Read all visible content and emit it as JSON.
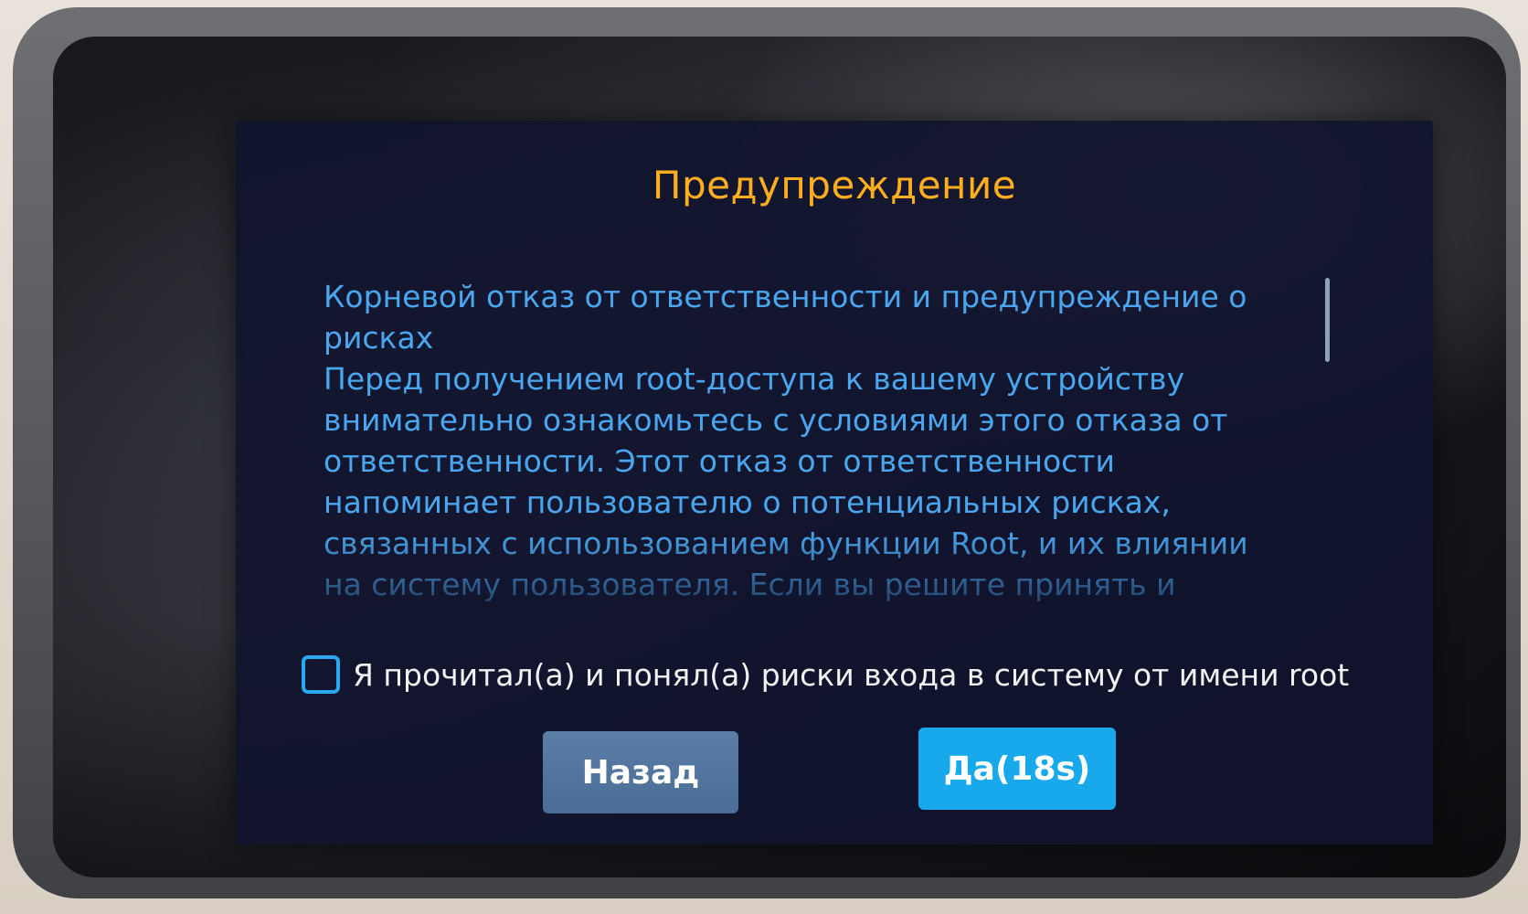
{
  "dialog": {
    "title": "Предупреждение",
    "body": "Корневой отказ от ответственности и предупреждение о рисках\nПеред получением root-доступа к вашему устройству внимательно ознакомьтесь с условиями этого отказа от ответственности. Этот отказ от ответственности напоминает пользователю о потенциальных рисках, связанных с использованием функции Root, и их влиянии на систему пользователя. Если вы решите принять и продолжить использование Root, вы должны",
    "consent_label": "Я прочитал(а) и понял(а) риски входа в систему от имени root",
    "consent_checked": false,
    "back_label": "Назад",
    "confirm_label": "Да(18s)"
  },
  "colors": {
    "title": "#ffae1f",
    "body_text": "#4aa6ee",
    "checkbox_border": "#2aa8f2",
    "confirm_button": "#18a8ec",
    "back_button": "#4f7199"
  }
}
